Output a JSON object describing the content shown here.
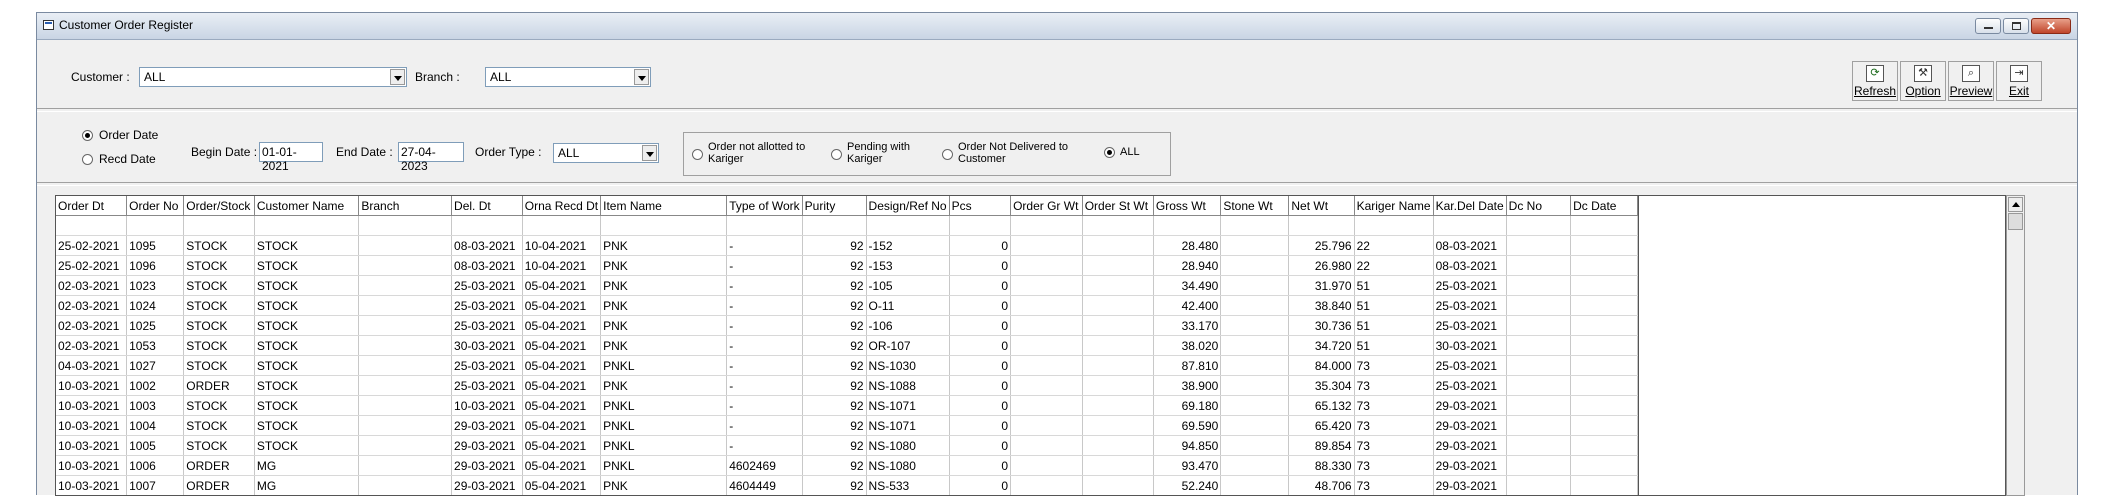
{
  "window": {
    "title": "Customer Order Register"
  },
  "filters": {
    "customer_label": "Customer :",
    "customer_value": "ALL",
    "branch_label": "Branch :",
    "branch_value": "ALL"
  },
  "toolbar": {
    "refresh_label": "Refresh",
    "option_label": "Option",
    "preview_label": "Preview",
    "exit_label": "Exit"
  },
  "date_filter": {
    "order_date_label": "Order Date",
    "order_date_selected": true,
    "recd_date_label": "Recd Date",
    "begin_label": "Begin Date :",
    "begin_value": "01-01-2021",
    "end_label": "End Date :",
    "end_value": "27-04-2023",
    "order_type_label": "Order Type :",
    "order_type_value": "ALL"
  },
  "status_filter": {
    "not_allotted_line1": "Order not allotted to",
    "not_allotted_line2": "Kariger",
    "pending_line1": "Pending with",
    "pending_line2": "Kariger",
    "not_delivered_line1": "Order Not Delivered to",
    "not_delivered_line2": "Customer",
    "all_label": "ALL",
    "selected": "ALL"
  },
  "grid": {
    "columns": [
      "Order Dt",
      "Order No",
      "Order/Stock",
      "Customer Name",
      "Branch",
      "Del. Dt",
      "Orna Recd Dt",
      "Item Name",
      "Type of Work",
      "Purity",
      "Design/Ref No",
      "Pcs",
      "Order Gr Wt",
      "Order St Wt",
      "Gross Wt",
      "Stone Wt",
      "Net Wt",
      "Kariger Name",
      "Kar.Del Date",
      "Dc No",
      "Dc Date"
    ],
    "rows": [
      [
        "",
        "",
        "",
        "",
        "",
        "",
        "",
        "",
        "",
        "",
        "",
        "",
        "",
        "",
        "",
        "",
        "",
        "",
        "",
        "",
        ""
      ],
      [
        "25-02-2021",
        "1095",
        "STOCK",
        "STOCK",
        "",
        "08-03-2021",
        "10-04-2021",
        "PNK",
        "-",
        "92",
        "-152",
        "0",
        "",
        "",
        "28.480",
        "",
        "25.796",
        "22",
        "08-03-2021",
        "",
        ""
      ],
      [
        "25-02-2021",
        "1096",
        "STOCK",
        "STOCK",
        "",
        "08-03-2021",
        "10-04-2021",
        "PNK",
        "-",
        "92",
        "-153",
        "0",
        "",
        "",
        "28.940",
        "",
        "26.980",
        "22",
        "08-03-2021",
        "",
        ""
      ],
      [
        "02-03-2021",
        "1023",
        "STOCK",
        "STOCK",
        "",
        "25-03-2021",
        "05-04-2021",
        "PNK",
        "-",
        "92",
        "-105",
        "0",
        "",
        "",
        "34.490",
        "",
        "31.970",
        "51",
        "25-03-2021",
        "",
        ""
      ],
      [
        "02-03-2021",
        "1024",
        "STOCK",
        "STOCK",
        "",
        "25-03-2021",
        "05-04-2021",
        "PNK",
        "-",
        "92",
        "O-11",
        "0",
        "",
        "",
        "42.400",
        "",
        "38.840",
        "51",
        "25-03-2021",
        "",
        ""
      ],
      [
        "02-03-2021",
        "1025",
        "STOCK",
        "STOCK",
        "",
        "25-03-2021",
        "05-04-2021",
        "PNK",
        "-",
        "92",
        "-106",
        "0",
        "",
        "",
        "33.170",
        "",
        "30.736",
        "51",
        "25-03-2021",
        "",
        ""
      ],
      [
        "02-03-2021",
        "1053",
        "STOCK",
        "STOCK",
        "",
        "30-03-2021",
        "05-04-2021",
        "PNK",
        "-",
        "92",
        "OR-107",
        "0",
        "",
        "",
        "38.020",
        "",
        "34.720",
        "51",
        "30-03-2021",
        "",
        ""
      ],
      [
        "04-03-2021",
        "1027",
        "STOCK",
        "STOCK",
        "",
        "25-03-2021",
        "05-04-2021",
        "PNKL",
        "-",
        "92",
        "NS-1030",
        "0",
        "",
        "",
        "87.810",
        "",
        "84.000",
        "73",
        "25-03-2021",
        "",
        ""
      ],
      [
        "10-03-2021",
        "1002",
        "ORDER",
        "STOCK",
        "",
        "25-03-2021",
        "05-04-2021",
        "PNK",
        "-",
        "92",
        "NS-1088",
        "0",
        "",
        "",
        "38.900",
        "",
        "35.304",
        "73",
        "25-03-2021",
        "",
        ""
      ],
      [
        "10-03-2021",
        "1003",
        "STOCK",
        "STOCK",
        "",
        "10-03-2021",
        "05-04-2021",
        "PNKL",
        "-",
        "92",
        "NS-1071",
        "0",
        "",
        "",
        "69.180",
        "",
        "65.132",
        "73",
        "29-03-2021",
        "",
        ""
      ],
      [
        "10-03-2021",
        "1004",
        "STOCK",
        "STOCK",
        "",
        "29-03-2021",
        "05-04-2021",
        "PNKL",
        "-",
        "92",
        "NS-1071",
        "0",
        "",
        "",
        "69.590",
        "",
        "65.420",
        "73",
        "29-03-2021",
        "",
        ""
      ],
      [
        "10-03-2021",
        "1005",
        "STOCK",
        "STOCK",
        "",
        "29-03-2021",
        "05-04-2021",
        "PNKL",
        "-",
        "92",
        "NS-1080",
        "0",
        "",
        "",
        "94.850",
        "",
        "89.854",
        "73",
        "29-03-2021",
        "",
        ""
      ],
      [
        "10-03-2021",
        "1006",
        "ORDER",
        "MG",
        "",
        "29-03-2021",
        "05-04-2021",
        "PNKL",
        "4602469",
        "92",
        "NS-1080",
        "0",
        "",
        "",
        "93.470",
        "",
        "88.330",
        "73",
        "29-03-2021",
        "",
        ""
      ],
      [
        "10-03-2021",
        "1007",
        "ORDER",
        "MG",
        "",
        "29-03-2021",
        "05-04-2021",
        "PNK",
        "4604449",
        "92",
        "NS-533",
        "0",
        "",
        "",
        "52.240",
        "",
        "48.706",
        "73",
        "29-03-2021",
        "",
        ""
      ]
    ]
  }
}
